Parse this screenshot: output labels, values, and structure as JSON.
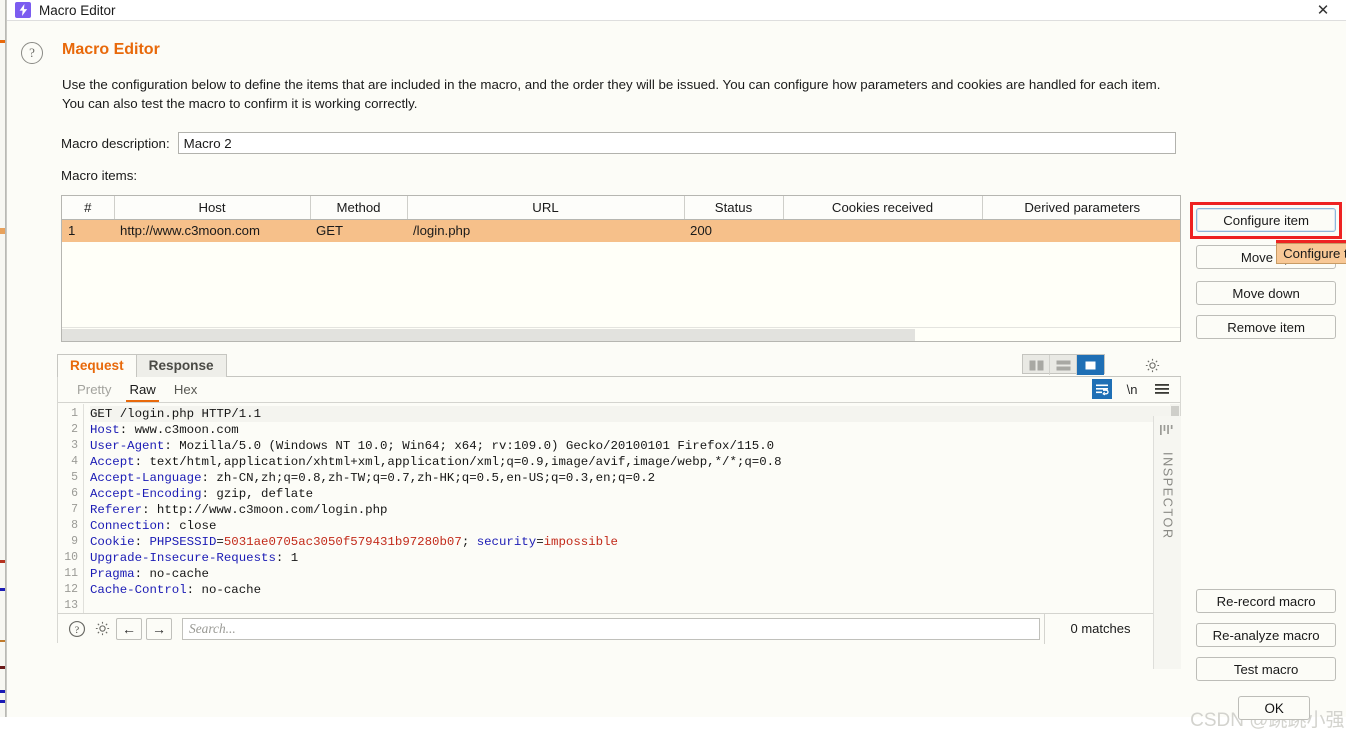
{
  "titlebar": {
    "title": "Macro Editor",
    "app_icon": "lightning-bolt-icon",
    "close_label": "✕",
    "icon_color": "#7b5cf0"
  },
  "header": {
    "help_icon": "question-mark-icon",
    "title": "Macro Editor",
    "title_color": "#e8690b",
    "description": "Use the configuration below to define the items that are included in the macro, and the order they will be issued. You can configure how parameters and cookies are handled for each item. You can also test the macro to confirm it is working correctly."
  },
  "form": {
    "macro_description_label": "Macro description:",
    "macro_description_value": "Macro 2",
    "macro_description_placeholder": "",
    "macro_items_label": "Macro items:"
  },
  "items_table": {
    "columns": [
      "#",
      "Host",
      "Method",
      "URL",
      "Status",
      "Cookies received",
      "Derived parameters"
    ],
    "rows": [
      {
        "num": "1",
        "host": "http://www.c3moon.com",
        "method": "GET",
        "url": "/login.php",
        "status": "200",
        "cookies": "",
        "derived": "",
        "selected": true,
        "selection_color": "#f6c08a"
      }
    ]
  },
  "right_buttons": {
    "configure_item": "Configure item",
    "move_up": "Move up",
    "move_down": "Move down",
    "remove_item": "Remove item",
    "re_record_macro": "Re-record macro",
    "re_analyze_macro": "Re-analyze macro",
    "test_macro": "Test macro",
    "ok": "OK",
    "highlight_color": "#ee2222"
  },
  "tooltip": {
    "text": "Configure t",
    "bg_color": "#f8c896"
  },
  "message_tabs": {
    "tabs": [
      {
        "label": "Request",
        "active": true
      },
      {
        "label": "Response",
        "active": false
      }
    ],
    "view_toggles": [
      {
        "icon": "split-vertical-icon",
        "active": false
      },
      {
        "icon": "split-horizontal-icon",
        "active": false
      },
      {
        "icon": "single-pane-icon",
        "active": true
      }
    ],
    "settings_icon": "gear-icon",
    "active_accent": "#1f6fb5"
  },
  "editor": {
    "sub_tabs": [
      {
        "label": "Pretty",
        "state": "disabled"
      },
      {
        "label": "Raw",
        "state": "active"
      },
      {
        "label": "Hex",
        "state": "normal"
      }
    ],
    "tools": [
      {
        "icon": "word-wrap-icon",
        "active": true
      },
      {
        "icon": "newline-icon",
        "label": "\\n",
        "active": false
      },
      {
        "icon": "hamburger-menu-icon",
        "active": false
      }
    ],
    "lines": [
      {
        "n": "1",
        "parts": [
          {
            "t": "GET /login.php HTTP/1.1",
            "c": "plain"
          }
        ]
      },
      {
        "n": "2",
        "parts": [
          {
            "t": "Host",
            "c": "hn"
          },
          {
            "t": ": www.c3moon.com",
            "c": "plain"
          }
        ]
      },
      {
        "n": "3",
        "parts": [
          {
            "t": "User-Agent",
            "c": "hn"
          },
          {
            "t": ": Mozilla/5.0 (Windows NT 10.0; Win64; x64; rv:109.0) Gecko/20100101 Firefox/115.0",
            "c": "plain"
          }
        ]
      },
      {
        "n": "4",
        "parts": [
          {
            "t": "Accept",
            "c": "hn"
          },
          {
            "t": ": text/html,application/xhtml+xml,application/xml;q=0.9,image/avif,image/webp,*/*;q=0.8",
            "c": "plain"
          }
        ]
      },
      {
        "n": "5",
        "parts": [
          {
            "t": "Accept-Language",
            "c": "hn"
          },
          {
            "t": ": zh-CN,zh;q=0.8,zh-TW;q=0.7,zh-HK;q=0.5,en-US;q=0.3,en;q=0.2",
            "c": "plain"
          }
        ]
      },
      {
        "n": "6",
        "parts": [
          {
            "t": "Accept-Encoding",
            "c": "hn"
          },
          {
            "t": ": gzip, deflate",
            "c": "plain"
          }
        ]
      },
      {
        "n": "7",
        "parts": [
          {
            "t": "Referer",
            "c": "hn"
          },
          {
            "t": ": http://www.c3moon.com/login.php",
            "c": "plain"
          }
        ]
      },
      {
        "n": "8",
        "parts": [
          {
            "t": "Connection",
            "c": "hn"
          },
          {
            "t": ": close",
            "c": "plain"
          }
        ]
      },
      {
        "n": "9",
        "parts": [
          {
            "t": "Cookie",
            "c": "hn"
          },
          {
            "t": ": ",
            "c": "plain"
          },
          {
            "t": "PHPSESSID",
            "c": "hn"
          },
          {
            "t": "=",
            "c": "plain"
          },
          {
            "t": "5031ae0705ac3050f579431b97280b07",
            "c": "red"
          },
          {
            "t": "; ",
            "c": "plain"
          },
          {
            "t": "security",
            "c": "hn"
          },
          {
            "t": "=",
            "c": "plain"
          },
          {
            "t": "impossible",
            "c": "red"
          }
        ]
      },
      {
        "n": "10",
        "parts": [
          {
            "t": "Upgrade-Insecure-Requests",
            "c": "hn"
          },
          {
            "t": ": 1",
            "c": "plain"
          }
        ]
      },
      {
        "n": "11",
        "parts": [
          {
            "t": "Pragma",
            "c": "hn"
          },
          {
            "t": ": no-cache",
            "c": "plain"
          }
        ]
      },
      {
        "n": "12",
        "parts": [
          {
            "t": "Cache-Control",
            "c": "hn"
          },
          {
            "t": ": no-cache",
            "c": "plain"
          }
        ]
      },
      {
        "n": "13",
        "parts": [
          {
            "t": "",
            "c": "plain"
          }
        ]
      }
    ]
  },
  "search_bar": {
    "help_icon": "question-mark-icon",
    "settings_icon": "gear-icon",
    "prev_label": "←",
    "next_label": "→",
    "placeholder": "Search...",
    "value": "",
    "matches": "0 matches"
  },
  "inspector": {
    "label": "INSPECTOR",
    "icon": "inspector-bars-icon"
  },
  "watermark": {
    "text": "CSDN @跳跳小强"
  }
}
